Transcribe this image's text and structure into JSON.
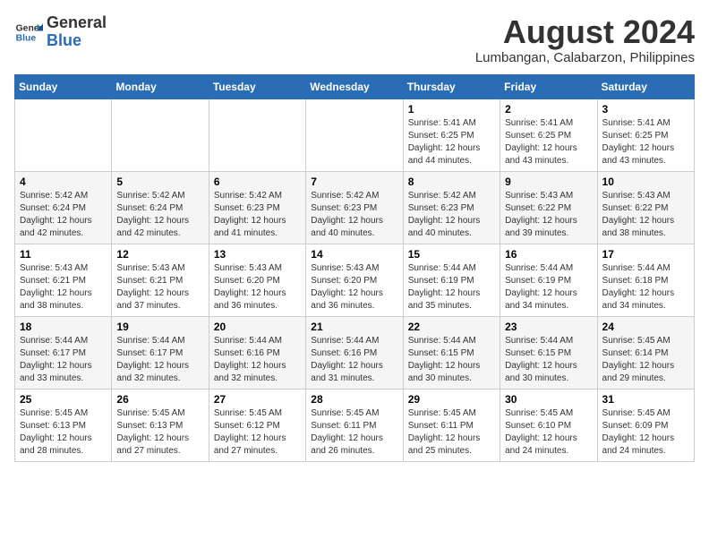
{
  "header": {
    "logo_general": "General",
    "logo_blue": "Blue",
    "month_year": "August 2024",
    "location": "Lumbangan, Calabarzon, Philippines"
  },
  "days_of_week": [
    "Sunday",
    "Monday",
    "Tuesday",
    "Wednesday",
    "Thursday",
    "Friday",
    "Saturday"
  ],
  "weeks": [
    [
      {
        "day": "",
        "info": ""
      },
      {
        "day": "",
        "info": ""
      },
      {
        "day": "",
        "info": ""
      },
      {
        "day": "",
        "info": ""
      },
      {
        "day": "1",
        "info": "Sunrise: 5:41 AM\nSunset: 6:25 PM\nDaylight: 12 hours\nand 44 minutes."
      },
      {
        "day": "2",
        "info": "Sunrise: 5:41 AM\nSunset: 6:25 PM\nDaylight: 12 hours\nand 43 minutes."
      },
      {
        "day": "3",
        "info": "Sunrise: 5:41 AM\nSunset: 6:25 PM\nDaylight: 12 hours\nand 43 minutes."
      }
    ],
    [
      {
        "day": "4",
        "info": "Sunrise: 5:42 AM\nSunset: 6:24 PM\nDaylight: 12 hours\nand 42 minutes."
      },
      {
        "day": "5",
        "info": "Sunrise: 5:42 AM\nSunset: 6:24 PM\nDaylight: 12 hours\nand 42 minutes."
      },
      {
        "day": "6",
        "info": "Sunrise: 5:42 AM\nSunset: 6:23 PM\nDaylight: 12 hours\nand 41 minutes."
      },
      {
        "day": "7",
        "info": "Sunrise: 5:42 AM\nSunset: 6:23 PM\nDaylight: 12 hours\nand 40 minutes."
      },
      {
        "day": "8",
        "info": "Sunrise: 5:42 AM\nSunset: 6:23 PM\nDaylight: 12 hours\nand 40 minutes."
      },
      {
        "day": "9",
        "info": "Sunrise: 5:43 AM\nSunset: 6:22 PM\nDaylight: 12 hours\nand 39 minutes."
      },
      {
        "day": "10",
        "info": "Sunrise: 5:43 AM\nSunset: 6:22 PM\nDaylight: 12 hours\nand 38 minutes."
      }
    ],
    [
      {
        "day": "11",
        "info": "Sunrise: 5:43 AM\nSunset: 6:21 PM\nDaylight: 12 hours\nand 38 minutes."
      },
      {
        "day": "12",
        "info": "Sunrise: 5:43 AM\nSunset: 6:21 PM\nDaylight: 12 hours\nand 37 minutes."
      },
      {
        "day": "13",
        "info": "Sunrise: 5:43 AM\nSunset: 6:20 PM\nDaylight: 12 hours\nand 36 minutes."
      },
      {
        "day": "14",
        "info": "Sunrise: 5:43 AM\nSunset: 6:20 PM\nDaylight: 12 hours\nand 36 minutes."
      },
      {
        "day": "15",
        "info": "Sunrise: 5:44 AM\nSunset: 6:19 PM\nDaylight: 12 hours\nand 35 minutes."
      },
      {
        "day": "16",
        "info": "Sunrise: 5:44 AM\nSunset: 6:19 PM\nDaylight: 12 hours\nand 34 minutes."
      },
      {
        "day": "17",
        "info": "Sunrise: 5:44 AM\nSunset: 6:18 PM\nDaylight: 12 hours\nand 34 minutes."
      }
    ],
    [
      {
        "day": "18",
        "info": "Sunrise: 5:44 AM\nSunset: 6:17 PM\nDaylight: 12 hours\nand 33 minutes."
      },
      {
        "day": "19",
        "info": "Sunrise: 5:44 AM\nSunset: 6:17 PM\nDaylight: 12 hours\nand 32 minutes."
      },
      {
        "day": "20",
        "info": "Sunrise: 5:44 AM\nSunset: 6:16 PM\nDaylight: 12 hours\nand 32 minutes."
      },
      {
        "day": "21",
        "info": "Sunrise: 5:44 AM\nSunset: 6:16 PM\nDaylight: 12 hours\nand 31 minutes."
      },
      {
        "day": "22",
        "info": "Sunrise: 5:44 AM\nSunset: 6:15 PM\nDaylight: 12 hours\nand 30 minutes."
      },
      {
        "day": "23",
        "info": "Sunrise: 5:44 AM\nSunset: 6:15 PM\nDaylight: 12 hours\nand 30 minutes."
      },
      {
        "day": "24",
        "info": "Sunrise: 5:45 AM\nSunset: 6:14 PM\nDaylight: 12 hours\nand 29 minutes."
      }
    ],
    [
      {
        "day": "25",
        "info": "Sunrise: 5:45 AM\nSunset: 6:13 PM\nDaylight: 12 hours\nand 28 minutes."
      },
      {
        "day": "26",
        "info": "Sunrise: 5:45 AM\nSunset: 6:13 PM\nDaylight: 12 hours\nand 27 minutes."
      },
      {
        "day": "27",
        "info": "Sunrise: 5:45 AM\nSunset: 6:12 PM\nDaylight: 12 hours\nand 27 minutes."
      },
      {
        "day": "28",
        "info": "Sunrise: 5:45 AM\nSunset: 6:11 PM\nDaylight: 12 hours\nand 26 minutes."
      },
      {
        "day": "29",
        "info": "Sunrise: 5:45 AM\nSunset: 6:11 PM\nDaylight: 12 hours\nand 25 minutes."
      },
      {
        "day": "30",
        "info": "Sunrise: 5:45 AM\nSunset: 6:10 PM\nDaylight: 12 hours\nand 24 minutes."
      },
      {
        "day": "31",
        "info": "Sunrise: 5:45 AM\nSunset: 6:09 PM\nDaylight: 12 hours\nand 24 minutes."
      }
    ]
  ]
}
